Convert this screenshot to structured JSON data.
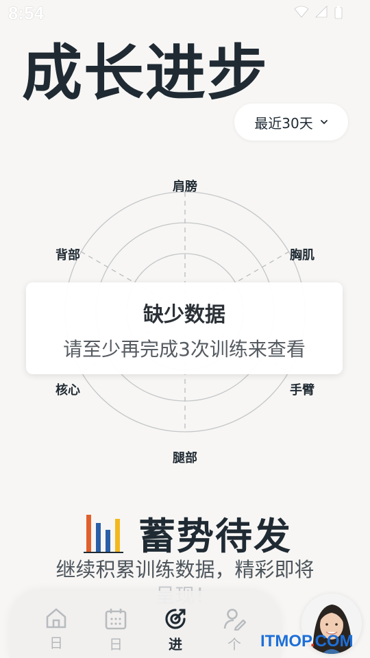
{
  "status_bar": {
    "time": "8:54"
  },
  "page": {
    "title": "成长进步"
  },
  "range_selector": {
    "value": "最近30天"
  },
  "radar": {
    "labels": [
      "肩膀",
      "胸肌",
      "手臂",
      "腿部",
      "核心",
      "背部"
    ]
  },
  "empty_state": {
    "title": "缺少数据",
    "message": "请至少再完成3次训练来查看"
  },
  "banner": {
    "title": "蓄势待发",
    "subtitle_line1": "继续积累训练数据，精彩即将",
    "subtitle_line2": "呈现！"
  },
  "bottom_nav": {
    "items": [
      {
        "label": "日",
        "icon": "home-icon"
      },
      {
        "label": "日",
        "icon": "calendar-icon"
      },
      {
        "label": "进",
        "icon": "progress-icon",
        "active": true
      },
      {
        "label": "个",
        "icon": "profile-icon"
      }
    ]
  },
  "watermark": {
    "text": "ITMOP",
    "dot": ".",
    "suffix": "COM"
  },
  "colors": {
    "bar_orange": "#e0602c",
    "bar_blue": "#2a5fa8",
    "bar_yellow": "#f2b81f",
    "text_dark": "#1f2a33"
  }
}
